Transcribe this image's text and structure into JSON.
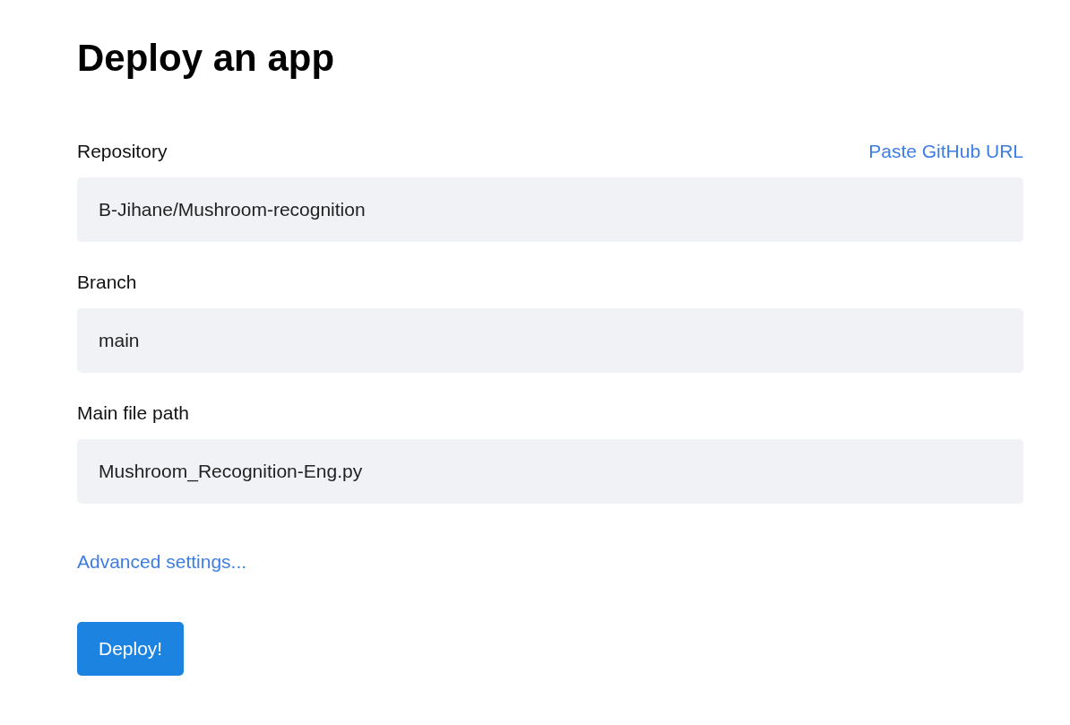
{
  "title": "Deploy an app",
  "fields": [
    {
      "label": "Repository",
      "value": "B-Jihane/Mushroom-recognition",
      "link": "Paste GitHub URL"
    },
    {
      "label": "Branch",
      "value": "main"
    },
    {
      "label": "Main file path",
      "value": "Mushroom_Recognition-Eng.py"
    }
  ],
  "advanced_link": "Advanced settings...",
  "button": "Deploy!"
}
